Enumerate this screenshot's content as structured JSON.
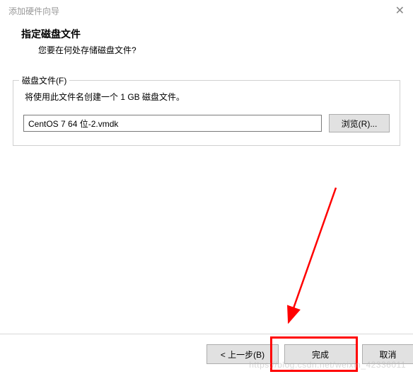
{
  "titlebar": {
    "title": "添加硬件向导",
    "close_aria": "Close"
  },
  "header": {
    "heading": "指定磁盘文件",
    "subheading": "您要在何处存储磁盘文件?"
  },
  "group": {
    "legend": "磁盘文件(F)",
    "description": "将使用此文件名创建一个 1 GB 磁盘文件。",
    "file_value": "CentOS 7 64 位-2.vmdk",
    "browse_label": "浏览(R)..."
  },
  "buttons": {
    "back": "< 上一步(B)",
    "finish": "完成",
    "cancel": "取消"
  },
  "watermark": "https://blog.csdn.net/weixin_42336011"
}
